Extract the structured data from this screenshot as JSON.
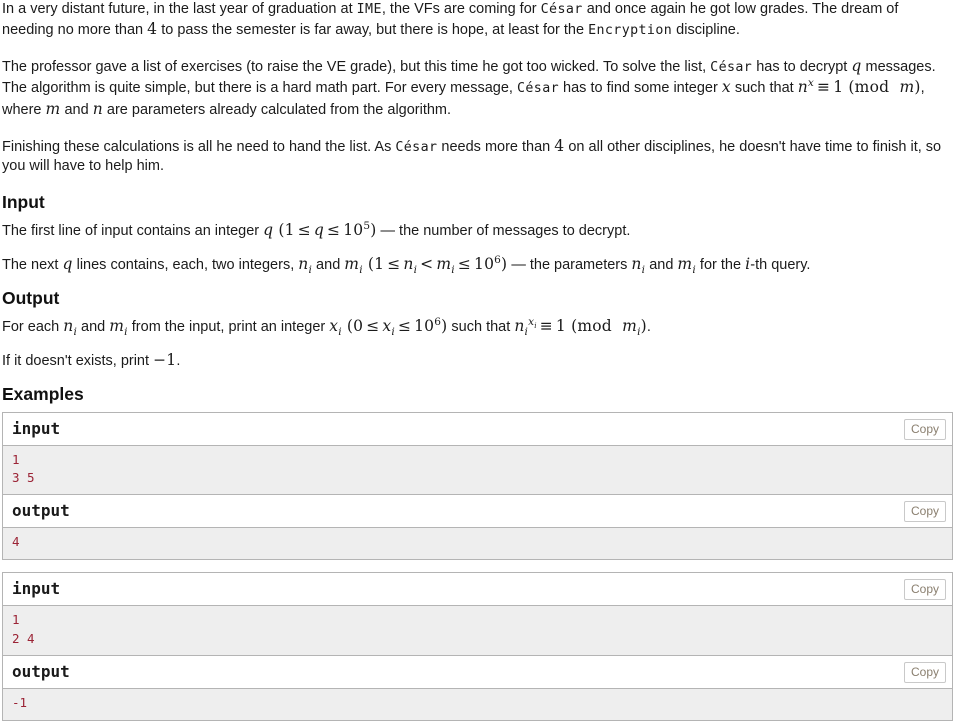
{
  "problem": {
    "paragraphs": [
      {
        "id": "p1",
        "segments": [
          {
            "t": "text",
            "v": "In a very distant future, in the last year of graduation at "
          },
          {
            "t": "tt",
            "v": "IME"
          },
          {
            "t": "text",
            "v": ", the VFs are coming for "
          },
          {
            "t": "tt",
            "v": "César"
          },
          {
            "t": "text",
            "v": " and once again he got low grades. The dream of needing no more than "
          },
          {
            "t": "math",
            "v": "4"
          },
          {
            "t": "text",
            "v": " to pass the semester is far away, but there is hope, at least for the "
          },
          {
            "t": "tt",
            "v": "Encryption"
          },
          {
            "t": "text",
            "v": " discipline."
          }
        ]
      },
      {
        "id": "p2",
        "segments": [
          {
            "t": "text",
            "v": "The professor gave a list of exercises (to raise the VE grade), but this time he got too wicked. To solve the list, "
          },
          {
            "t": "tt",
            "v": "César"
          },
          {
            "t": "text",
            "v": " has to decrypt "
          },
          {
            "t": "math",
            "v": "q"
          },
          {
            "t": "text",
            "v": " messages. The algorithm is quite simple, but there is a hard math part. For every message, "
          },
          {
            "t": "tt",
            "v": "César"
          },
          {
            "t": "text",
            "v": " has to find some integer "
          },
          {
            "t": "math",
            "v": "x"
          },
          {
            "t": "text",
            "v": " such that "
          },
          {
            "t": "math",
            "v": "n^x ≡ 1 (mod m)"
          },
          {
            "t": "text",
            "v": ", where "
          },
          {
            "t": "math",
            "v": "m"
          },
          {
            "t": "text",
            "v": " and "
          },
          {
            "t": "math",
            "v": "n"
          },
          {
            "t": "text",
            "v": " are parameters already calculated from the algorithm."
          }
        ]
      },
      {
        "id": "p3",
        "segments": [
          {
            "t": "text",
            "v": "Finishing these calculations is all he need to hand the list. As "
          },
          {
            "t": "tt",
            "v": "César"
          },
          {
            "t": "text",
            "v": " needs more than "
          },
          {
            "t": "math",
            "v": "4"
          },
          {
            "t": "text",
            "v": " on all other disciplines, he doesn't have time to finish it, so you will have to help him."
          }
        ]
      }
    ]
  },
  "sections": {
    "input_heading": "Input",
    "input_line1_pre": "The first line of input contains an integer ",
    "input_line1_math": "q (1 ≤ q ≤ 10^5)",
    "input_line1_post": " — the number of messages to decrypt.",
    "input_line2_pre": "The next ",
    "input_line2_q": "q",
    "input_line2_mid": " lines contains, each, two integers, ",
    "input_line2_math": "n_i and m_i (1 ≤ n_i < m_i ≤ 10^6)",
    "input_line2_post": " — the parameters ",
    "input_line2_params": "n_i and m_i",
    "input_line2_end": " for the ",
    "input_line2_i": "i",
    "input_line2_tail": "-th query.",
    "output_heading": "Output",
    "output_line1_pre": "For each ",
    "output_line1_nm": "n_i and m_i",
    "output_line1_mid": " from the input, print an integer ",
    "output_line1_math": "x_i (0 ≤ x_i ≤ 10^6)",
    "output_line1_such": " such that ",
    "output_line1_cong": "n_i^{x_i} ≡ 1 (mod m_i)",
    "output_line1_end": ".",
    "output_line2_pre": "If it doesn't exists, print ",
    "output_line2_val": "−1",
    "output_line2_end": ".",
    "examples_heading": "Examples"
  },
  "examples": [
    {
      "input_label": "input",
      "input_copy": "Copy",
      "input_text": "1\n3 5",
      "output_label": "output",
      "output_copy": "Copy",
      "output_text": "4"
    },
    {
      "input_label": "input",
      "input_copy": "Copy",
      "input_text": "1\n2 4",
      "output_label": "output",
      "output_copy": "Copy",
      "output_text": "-1"
    }
  ],
  "colors": {
    "body_text": "#1b1b1b",
    "sample_border": "#b4b4b4",
    "sample_body_bg": "#eeeeee",
    "sample_text": "#9b2335",
    "copy_border": "#c9c9c9",
    "copy_text": "#8a7f6f"
  }
}
